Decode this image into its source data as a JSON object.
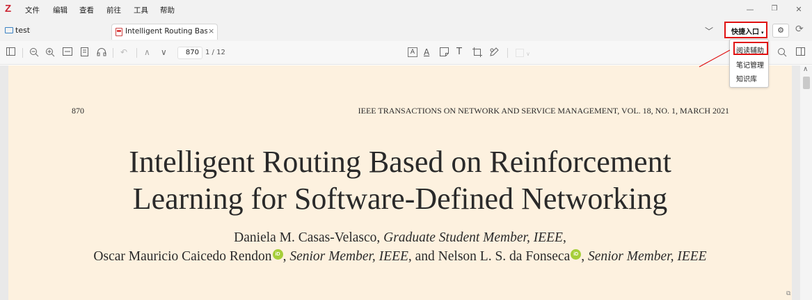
{
  "app": {
    "logo": "Z",
    "menu": [
      "文件",
      "编辑",
      "查看",
      "前往",
      "工具",
      "帮助"
    ],
    "window_controls": {
      "minimize": "—",
      "restore": "❐",
      "close": "✕"
    }
  },
  "tabs": {
    "library": "test",
    "document": "Intelligent Routing Base",
    "close": "×",
    "overflow": "﹀",
    "quick_access": "快捷入口",
    "quick_caret": "▾"
  },
  "toolbar": {
    "page_input": "870",
    "page_total": "1 / 12"
  },
  "dropdown": {
    "items": [
      "阅读辅助",
      "笔记管理",
      "知识库"
    ]
  },
  "pdf": {
    "page_number": "870",
    "journal": "IEEE TRANSACTIONS ON NETWORK AND SERVICE MANAGEMENT, VOL. 18, NO. 1, MARCH 2021",
    "title_line1": "Intelligent Routing Based on Reinforcement",
    "title_line2": "Learning for Software-Defined Networking",
    "author1_name": "Daniela M. Casas-Velasco, ",
    "author1_role": "Graduate Student Member, IEEE",
    "author1_tail": ",",
    "author2_name": "Oscar Mauricio Caicedo Rendon",
    "author2_sep": ", ",
    "author2_role": "Senior Member, IEEE",
    "author3_join": ", and Nelson L. S. da Fonseca",
    "author3_sep": ", ",
    "author3_role": "Senior Member, IEEE",
    "orcid_label": "iD"
  },
  "colors": {
    "accent_red": "#e01010",
    "logo_red": "#cc2936",
    "page_background": "#fdf1df",
    "orcid_green": "#a6ce39"
  }
}
